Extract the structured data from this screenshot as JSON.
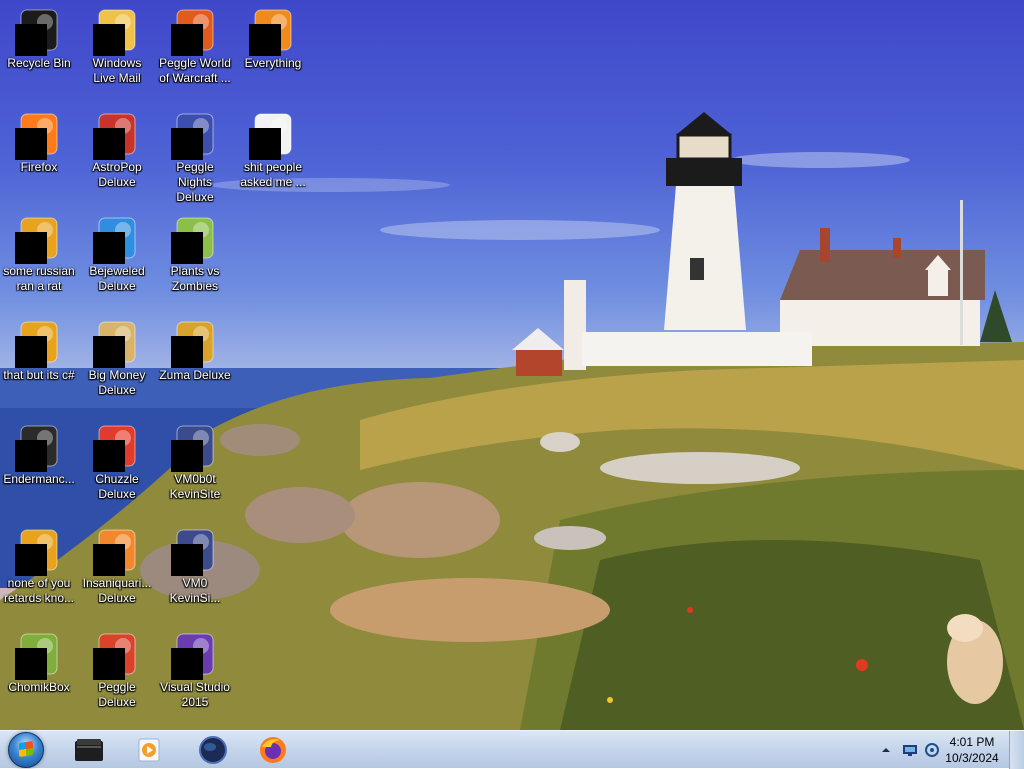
{
  "desktop": {
    "icons": [
      {
        "label": "Recycle Bin",
        "icon": "recycle-bin-icon"
      },
      {
        "label": "Windows Live Mail",
        "icon": "windows-live-mail-icon"
      },
      {
        "label": "Peggle World of Warcraft ...",
        "icon": "peggle-wow-icon"
      },
      {
        "label": "Everything",
        "icon": "everything-search-icon"
      },
      {
        "label": "Firefox",
        "icon": "firefox-icon"
      },
      {
        "label": "AstroPop Deluxe",
        "icon": "astropop-icon"
      },
      {
        "label": "Peggle Nights Deluxe",
        "icon": "peggle-nights-icon"
      },
      {
        "label": "shit people asked me ...",
        "icon": "folder-icon"
      },
      {
        "label": "some russian ran a rat",
        "icon": "file-icon"
      },
      {
        "label": "Bejeweled Deluxe",
        "icon": "bejeweled-icon"
      },
      {
        "label": "Plants vs Zombies",
        "icon": "plants-vs-zombies-icon"
      },
      {
        "label": "that but its c#",
        "icon": "file-icon"
      },
      {
        "label": "Big Money Deluxe",
        "icon": "big-money-icon"
      },
      {
        "label": "Zuma Deluxe",
        "icon": "zuma-icon"
      },
      {
        "label": "Endermanc...",
        "icon": "app-window-icon"
      },
      {
        "label": "Chuzzle Deluxe",
        "icon": "chuzzle-icon"
      },
      {
        "label": "VM0b0t KevinSite",
        "icon": "shortcut-icon"
      },
      {
        "label": "none of you retards kno...",
        "icon": "file-icon"
      },
      {
        "label": "Insaniquari... Deluxe",
        "icon": "insaniquarium-icon"
      },
      {
        "label": "VM0 KevinSi...",
        "icon": "shortcut-icon"
      },
      {
        "label": "ChomikBox",
        "icon": "chomikbox-icon"
      },
      {
        "label": "Peggle Deluxe",
        "icon": "peggle-icon"
      },
      {
        "label": "Visual Studio 2015",
        "icon": "visual-studio-icon"
      }
    ]
  },
  "taskbar": {
    "start_icon": "windows-orb-icon",
    "pinned": [
      {
        "icon": "file-explorer-icon"
      },
      {
        "icon": "media-player-icon"
      },
      {
        "icon": "browser-globe-icon"
      },
      {
        "icon": "firefox-icon"
      }
    ],
    "tray": {
      "time": "4:01 PM",
      "date": "10/3/2024",
      "icons": [
        "show-hidden-icons-chevron-icon",
        "network-icon",
        "volume-icon"
      ]
    }
  },
  "colors": {
    "taskbar_top": "#dbe7f5",
    "taskbar_bottom": "#b5c8e2",
    "icon_label": "#ffffff"
  }
}
